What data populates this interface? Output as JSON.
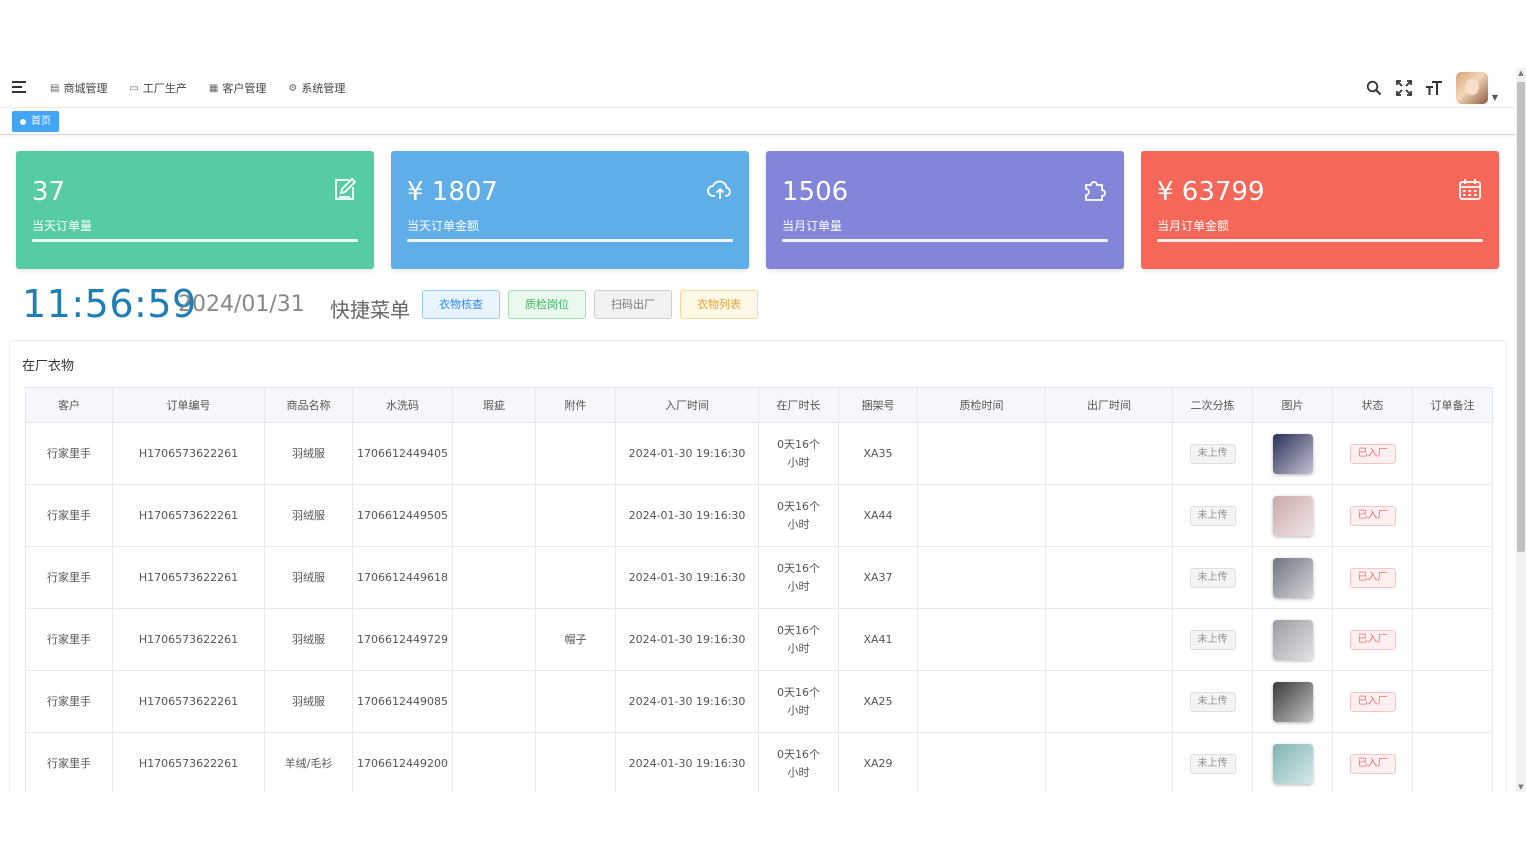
{
  "nav": {
    "menu": [
      {
        "label": "商城管理",
        "icon": "grid-icon"
      },
      {
        "label": "工厂生产",
        "icon": "monitor-icon"
      },
      {
        "label": "客户管理",
        "icon": "table-icon"
      },
      {
        "label": "系统管理",
        "icon": "gear-icon"
      }
    ]
  },
  "tags": {
    "active": "首页"
  },
  "cards": [
    {
      "value": "37",
      "label": "当天订单量",
      "color": "#56cca5",
      "icon": "edit-icon"
    },
    {
      "value": "¥ 1807",
      "label": "当天订单金额",
      "color": "#60aee8",
      "icon": "cloud-upload-icon"
    },
    {
      "value": "1506",
      "label": "当月订单量",
      "color": "#8385d8",
      "icon": "puzzle-icon"
    },
    {
      "value": "¥ 63799",
      "label": "当月订单金额",
      "color": "#f6675a",
      "icon": "calendar-icon"
    }
  ],
  "clock": {
    "time": "11:56:59",
    "date": "2024/01/31"
  },
  "quick": {
    "title": "快捷菜单",
    "buttons": [
      "衣物核查",
      "质检岗位",
      "扫码出厂",
      "衣物列表"
    ]
  },
  "panel": {
    "title": "在厂衣物"
  },
  "table": {
    "columns": [
      "客户",
      "订单编号",
      "商品名称",
      "水洗码",
      "瑕疵",
      "附件",
      "入厂时间",
      "在厂时长",
      "捆架号",
      "质检时间",
      "出厂时间",
      "二次分拣",
      "图片",
      "状态",
      "订单备注"
    ],
    "rows": [
      {
        "customer": "行家里手",
        "order": "H1706573622261",
        "product": "羽绒服",
        "code": "1706612449405",
        "defect": "",
        "attach": "",
        "in_time": "2024-01-30 19:16:30",
        "duration": "0天16个小时",
        "rack": "XA35",
        "qc_time": "",
        "out_time": "",
        "sort": "未上传",
        "status": "已入厂",
        "note": "",
        "thumb": "#2a2f5a"
      },
      {
        "customer": "行家里手",
        "order": "H1706573622261",
        "product": "羽绒服",
        "code": "1706612449505",
        "defect": "",
        "attach": "",
        "in_time": "2024-01-30 19:16:30",
        "duration": "0天16个小时",
        "rack": "XA44",
        "qc_time": "",
        "out_time": "",
        "sort": "未上传",
        "status": "已入厂",
        "note": "",
        "thumb": "#c9a9a8"
      },
      {
        "customer": "行家里手",
        "order": "H1706573622261",
        "product": "羽绒服",
        "code": "1706612449618",
        "defect": "",
        "attach": "",
        "in_time": "2024-01-30 19:16:30",
        "duration": "0天16个小时",
        "rack": "XA37",
        "qc_time": "",
        "out_time": "",
        "sort": "未上传",
        "status": "已入厂",
        "note": "",
        "thumb": "#6f7480"
      },
      {
        "customer": "行家里手",
        "order": "H1706573622261",
        "product": "羽绒服",
        "code": "1706612449729",
        "defect": "",
        "attach": "帽子",
        "in_time": "2024-01-30 19:16:30",
        "duration": "0天16个小时",
        "rack": "XA41",
        "qc_time": "",
        "out_time": "",
        "sort": "未上传",
        "status": "已入厂",
        "note": "",
        "thumb": "#9a9ca2"
      },
      {
        "customer": "行家里手",
        "order": "H1706573622261",
        "product": "羽绒服",
        "code": "1706612449085",
        "defect": "",
        "attach": "",
        "in_time": "2024-01-30 19:16:30",
        "duration": "0天16个小时",
        "rack": "XA25",
        "qc_time": "",
        "out_time": "",
        "sort": "未上传",
        "status": "已入厂",
        "note": "",
        "thumb": "#3a3a3c"
      },
      {
        "customer": "行家里手",
        "order": "H1706573622261",
        "product": "羊绒/毛衫",
        "code": "1706612449200",
        "defect": "",
        "attach": "",
        "in_time": "2024-01-30 19:16:30",
        "duration": "0天16个小时",
        "rack": "XA29",
        "qc_time": "",
        "out_time": "",
        "sort": "未上传",
        "status": "已入厂",
        "note": "",
        "thumb": "#7fb3b3"
      }
    ]
  }
}
